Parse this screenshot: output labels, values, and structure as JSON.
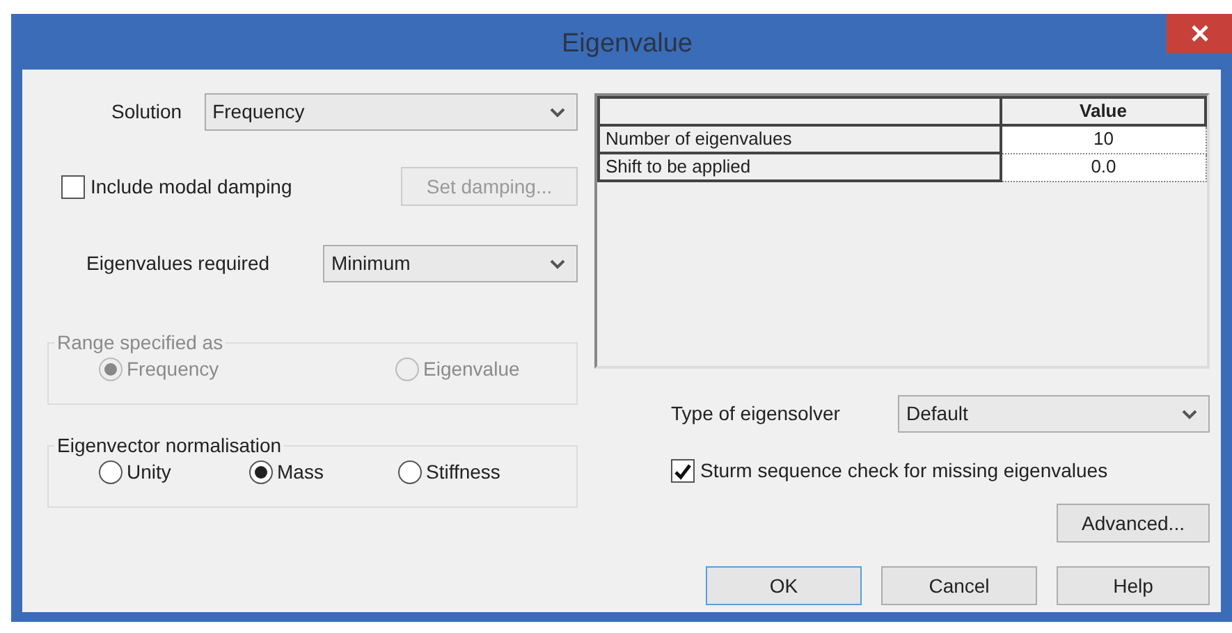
{
  "window": {
    "title": "Eigenvalue"
  },
  "solution": {
    "label": "Solution",
    "value": "Frequency"
  },
  "modal_damping": {
    "label": "Include modal damping",
    "checked": false
  },
  "set_damping_button": {
    "label": "Set damping...",
    "disabled": true
  },
  "eigenvalues_required": {
    "label": "Eigenvalues required",
    "value": "Minimum"
  },
  "range_group": {
    "legend": "Range specified as",
    "disabled": true,
    "options": [
      {
        "label": "Frequency",
        "selected": true
      },
      {
        "label": "Eigenvalue",
        "selected": false
      }
    ]
  },
  "normalisation_group": {
    "legend": "Eigenvector normalisation",
    "disabled": false,
    "options": [
      {
        "label": "Unity",
        "selected": false
      },
      {
        "label": "Mass",
        "selected": true
      },
      {
        "label": "Stiffness",
        "selected": false
      }
    ]
  },
  "table": {
    "columns": [
      "Value"
    ],
    "rows": [
      {
        "label": "Number of eigenvalues",
        "value": "10"
      },
      {
        "label": "Shift to be applied",
        "value": "0.0"
      }
    ]
  },
  "eigensolver": {
    "label": "Type of eigensolver",
    "value": "Default"
  },
  "sturm_check": {
    "label": "Sturm sequence check for missing eigenvalues",
    "checked": true
  },
  "advanced_button": {
    "label": "Advanced..."
  },
  "buttons": [
    {
      "label": "OK",
      "focused": true
    },
    {
      "label": "Cancel",
      "focused": false
    },
    {
      "label": "Help",
      "focused": false
    }
  ]
}
